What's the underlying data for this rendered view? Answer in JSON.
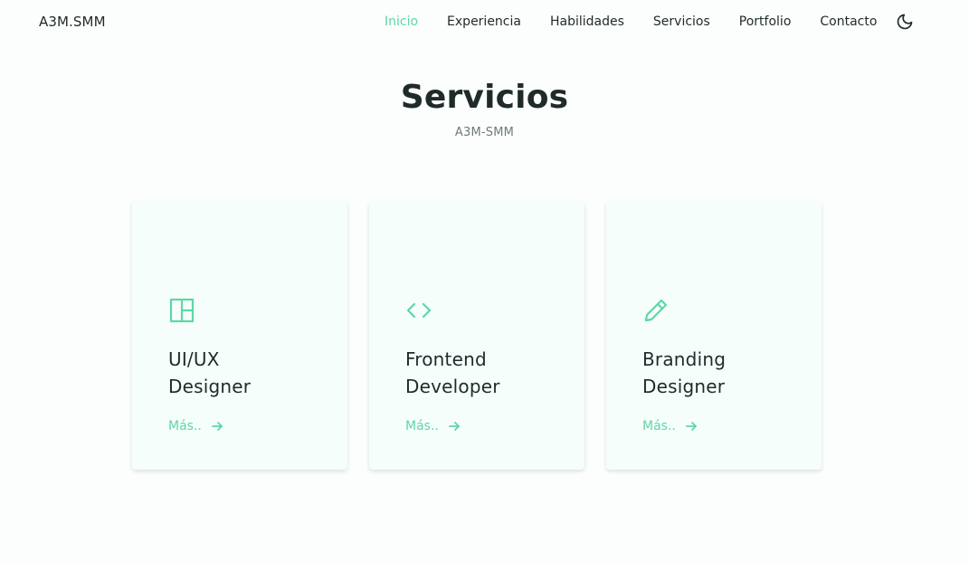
{
  "brand": {
    "name": "A3M.SMM",
    "accent": "#5fd6a6"
  },
  "nav": {
    "items": [
      {
        "label": "Inicio",
        "active": true
      },
      {
        "label": "Experiencia"
      },
      {
        "label": "Habilidades"
      },
      {
        "label": "Servicios"
      },
      {
        "label": "Portfolio"
      },
      {
        "label": "Contacto"
      }
    ],
    "theme_icon": "moon-icon"
  },
  "section": {
    "title": "Servicios",
    "subtitle": "A3M-SMM"
  },
  "services": [
    {
      "icon": "layout-icon",
      "title_line1": "UI/UX",
      "title_line2": "Designer",
      "more_label": "Más..",
      "more_icon": "arrow-right-icon"
    },
    {
      "icon": "code-icon",
      "title_line1": "Frontend",
      "title_line2": "Developer",
      "more_label": "Más..",
      "more_icon": "arrow-right-icon"
    },
    {
      "icon": "pencil-icon",
      "title_line1": "Branding",
      "title_line2": "Designer",
      "more_label": "Más..",
      "more_icon": "arrow-right-icon"
    }
  ]
}
